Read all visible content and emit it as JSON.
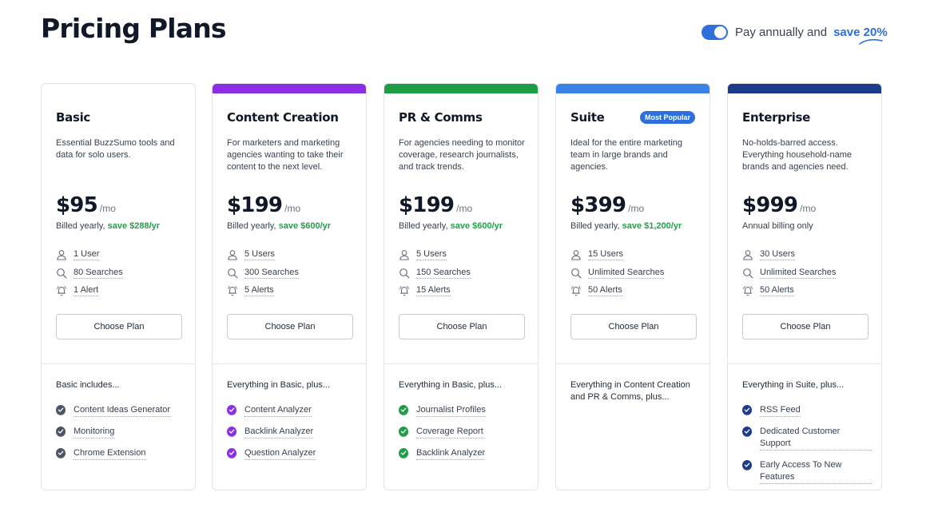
{
  "page": {
    "title": "Pricing Plans"
  },
  "billing_toggle": {
    "label": "Pay annually and",
    "save": "save 20%",
    "on": true,
    "accent": "#2f6fdb"
  },
  "plans": [
    {
      "name": "Basic",
      "badge": "",
      "bar_color": "",
      "description": "Essential BuzzSumo tools and data for solo users.",
      "price": "$95",
      "per": "/mo",
      "billing": "Billed yearly, ",
      "billing_save": "save $288/yr",
      "limits": [
        "1 User",
        "80 Searches",
        "1 Alert"
      ],
      "cta": "Choose Plan",
      "includes": "Basic includes...",
      "check_color": "#4b5563",
      "features": [
        "Content Ideas Generator",
        "Monitoring",
        "Chrome Extension"
      ]
    },
    {
      "name": "Content Creation",
      "badge": "",
      "bar_color": "#8b2fe6",
      "description": "For marketers and marketing agencies wanting to take their content to the next level.",
      "price": "$199",
      "per": "/mo",
      "billing": "Billed yearly, ",
      "billing_save": "save $600/yr",
      "limits": [
        "5 Users",
        "300 Searches",
        "5 Alerts"
      ],
      "cta": "Choose Plan",
      "includes": "Everything in Basic, plus...",
      "check_color": "#8b2fe6",
      "features": [
        "Content Analyzer",
        "Backlink Analyzer",
        "Question Analyzer"
      ]
    },
    {
      "name": "PR & Comms",
      "badge": "",
      "bar_color": "#1f9d46",
      "description": "For agencies needing to monitor coverage, research journalists, and track trends.",
      "price": "$199",
      "per": "/mo",
      "billing": "Billed yearly, ",
      "billing_save": "save $600/yr",
      "limits": [
        "5 Users",
        "150 Searches",
        "15 Alerts"
      ],
      "cta": "Choose Plan",
      "includes": "Everything in Basic, plus...",
      "check_color": "#1f9d46",
      "features": [
        "Journalist Profiles",
        "Coverage Report",
        "Backlink Analyzer"
      ]
    },
    {
      "name": "Suite",
      "badge": "Most Popular",
      "bar_color": "#3b82e6",
      "description": "Ideal for the entire marketing team in large brands and agencies.",
      "price": "$399",
      "per": "/mo",
      "billing": "Billed yearly, ",
      "billing_save": "save $1,200/yr",
      "limits": [
        "15 Users",
        "Unlimited Searches",
        "50 Alerts"
      ],
      "cta": "Choose Plan",
      "includes": "Everything in Content Creation and PR & Comms, plus...",
      "check_color": "#3b82e6",
      "features": []
    },
    {
      "name": "Enterprise",
      "badge": "",
      "bar_color": "#1e3a8a",
      "description": "No-holds-barred access. Everything household-name brands and agencies need.",
      "price": "$999",
      "per": "/mo",
      "billing": "Annual billing only",
      "billing_save": "",
      "limits": [
        "30 Users",
        "Unlimited Searches",
        "50 Alerts"
      ],
      "cta": "Choose Plan",
      "includes": "Everything in Suite, plus...",
      "check_color": "#1e3a8a",
      "features": [
        "RSS Feed",
        "Dedicated Customer Support",
        "Early Access To New Features"
      ]
    }
  ]
}
